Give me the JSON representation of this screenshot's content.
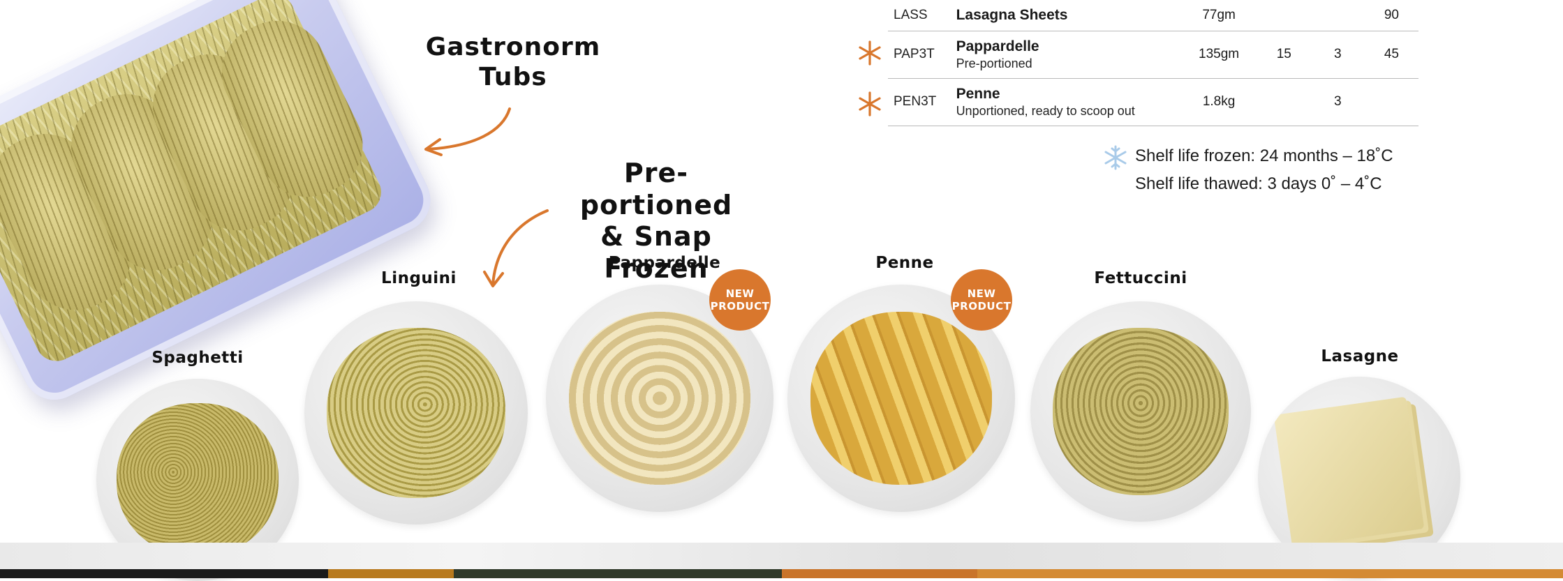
{
  "callouts": {
    "gastronorm": [
      "Gastronorm",
      "Tubs"
    ],
    "preportioned": [
      "Pre-portioned",
      "& Snap Frozen"
    ]
  },
  "table": {
    "rows": [
      {
        "code": "LASS",
        "name": "Lasagna Sheets",
        "desc": "",
        "weight": "77gm",
        "a": "",
        "b": "",
        "c": "90",
        "new": false
      },
      {
        "code": "PAP3T",
        "name": "Pappardelle",
        "desc": "Pre-portioned",
        "weight": "135gm",
        "a": "15",
        "b": "3",
        "c": "45",
        "new": true
      },
      {
        "code": "PEN3T",
        "name": "Penne",
        "desc": "Unportioned, ready to scoop out",
        "weight": "1.8kg",
        "a": "",
        "b": "3",
        "c": "",
        "new": true
      }
    ]
  },
  "shelf_life": {
    "frozen": "Shelf life frozen: 24 months – 18˚C",
    "thawed": "Shelf life thawed: 3 days 0˚ – 4˚C",
    "icon": "snowflake-icon"
  },
  "pastas": [
    {
      "label": "Spaghetti"
    },
    {
      "label": "Linguini"
    },
    {
      "label": "Pappardelle"
    },
    {
      "label": "Penne"
    },
    {
      "label": "Fettuccini"
    },
    {
      "label": "Lasagne"
    }
  ],
  "badges": {
    "line1": "NEW",
    "line2": "PRODUCT"
  },
  "colors": {
    "accent": "#d9772d",
    "snowflake": "#a9cbe9"
  }
}
